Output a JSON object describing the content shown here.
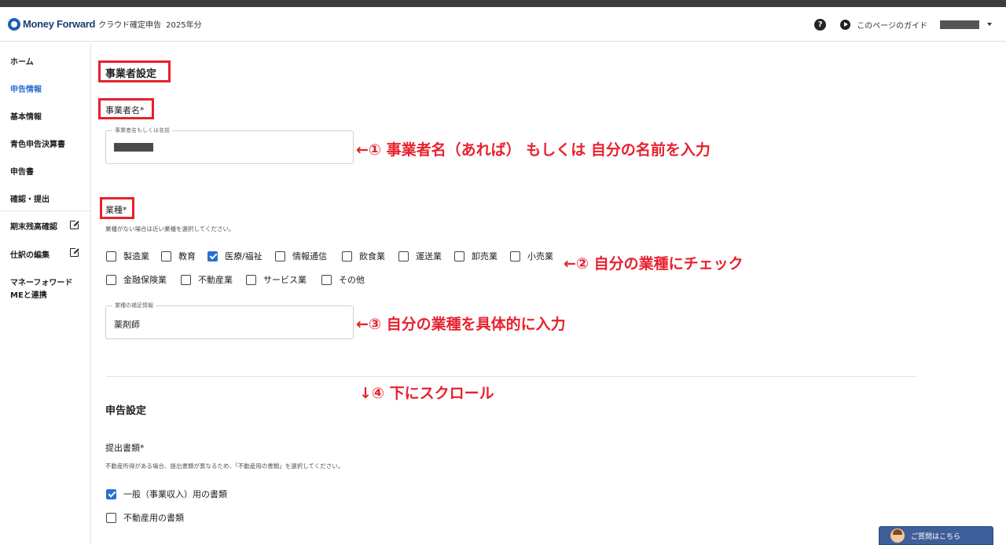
{
  "header": {
    "logo": "Money Forward",
    "product": "クラウド確定申告",
    "year": "2025年分",
    "help_icon": "?",
    "guide_label": "このページのガイド"
  },
  "sidebar": {
    "items": [
      {
        "label": "ホーム"
      },
      {
        "label": "申告情報",
        "active": true
      },
      {
        "label": "基本情報"
      },
      {
        "label": "青色申告決算書"
      },
      {
        "label": "申告書"
      },
      {
        "label": "確認・提出"
      },
      {
        "label": "期末残高確認",
        "icon": "external-link-icon"
      },
      {
        "label": "仕訳の編集",
        "icon": "external-link-icon"
      },
      {
        "label": "マネーフォワード"
      },
      {
        "label": "MEと連携"
      }
    ]
  },
  "business": {
    "section_title": "事業者設定",
    "name_label": "事業者名*",
    "name_field_legend": "事業者名もしくは名前",
    "industry_label": "業種*",
    "industry_note": "業種がない場合は近い業種を選択してください。",
    "industries": [
      {
        "label": "製造業",
        "checked": false
      },
      {
        "label": "教育",
        "checked": false
      },
      {
        "label": "医療/福祉",
        "checked": true
      },
      {
        "label": "情報通信",
        "checked": false
      },
      {
        "label": "飲食業",
        "checked": false
      },
      {
        "label": "運送業",
        "checked": false
      },
      {
        "label": "卸売業",
        "checked": false
      },
      {
        "label": "小売業",
        "checked": false
      },
      {
        "label": "金融保険業",
        "checked": false
      },
      {
        "label": "不動産業",
        "checked": false
      },
      {
        "label": "サービス業",
        "checked": false
      },
      {
        "label": "その他",
        "checked": false
      }
    ],
    "detail_field_legend": "業種の補足情報",
    "detail_field_value": "薬剤師"
  },
  "filing": {
    "section_title": "申告設定",
    "docs_label": "提出書類*",
    "docs_note": "不動産所得がある場合、提出書類が異なるため、「不動産用の書類」を選択してください。",
    "options": [
      {
        "label": "一般（事業収入）用の書類",
        "checked": true
      },
      {
        "label": "不動産用の書類",
        "checked": false
      }
    ]
  },
  "annotations": {
    "a1": "←① 事業者名（あれば） もしくは 自分の名前を入力",
    "a2": "←② 自分の業種にチェック",
    "a3": "←③ 自分の業種を具体的に入力",
    "a4": "↓④ 下にスクロール"
  },
  "help_button": {
    "label": "ご質問はこちら"
  },
  "colors": {
    "accent": "#2b6fd1",
    "annotation": "#e8212d",
    "brand": "#1e3e74"
  }
}
